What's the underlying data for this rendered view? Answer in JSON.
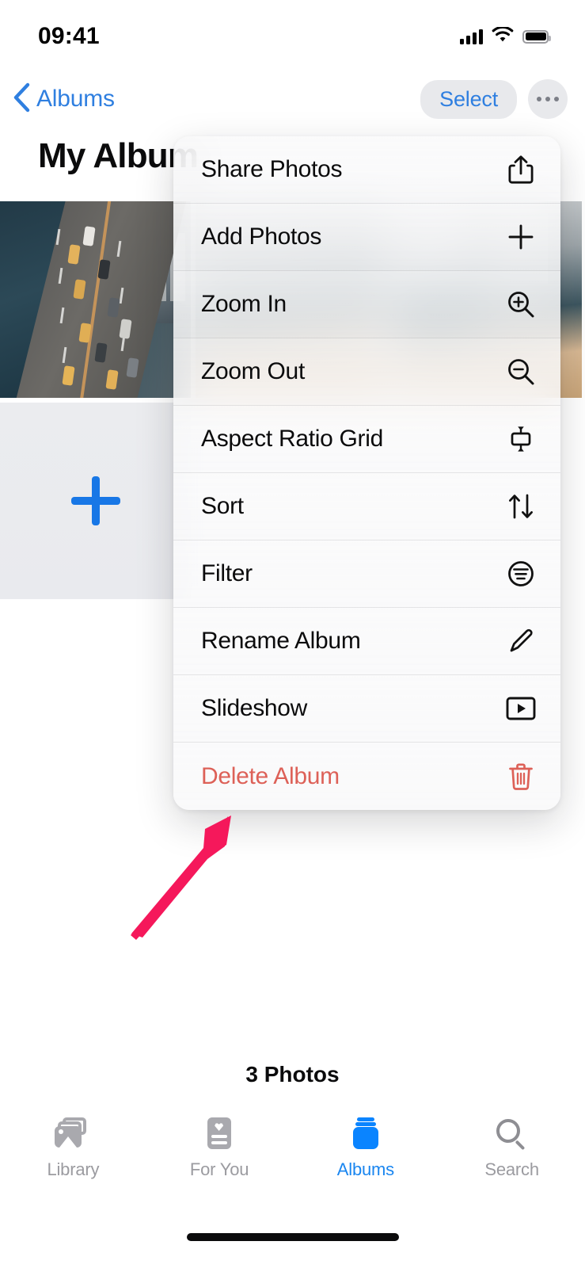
{
  "status_bar": {
    "time": "09:41",
    "cellular_icon": "signal-bars-icon",
    "wifi_icon": "wifi-icon",
    "battery_icon": "battery-full-icon"
  },
  "nav_bar": {
    "back_label": "Albums",
    "back_icon": "chevron-left-icon",
    "select_label": "Select",
    "more_icon": "ellipsis-icon"
  },
  "page": {
    "title": "My Album",
    "photo_count_label": "3 Photos"
  },
  "grid": {
    "add_tile_icon": "plus-icon",
    "photos": [
      {
        "alt": "aerial-highway-traffic"
      },
      {
        "alt": "city-street"
      },
      {
        "alt": "city-buildings"
      }
    ]
  },
  "context_menu": {
    "items": [
      {
        "label": "Share Photos",
        "icon": "share-icon",
        "destructive": false
      },
      {
        "label": "Add Photos",
        "icon": "plus-icon",
        "destructive": false
      },
      {
        "label": "Zoom In",
        "icon": "zoom-in-icon",
        "destructive": false
      },
      {
        "label": "Zoom Out",
        "icon": "zoom-out-icon",
        "destructive": false
      },
      {
        "label": "Aspect Ratio Grid",
        "icon": "aspect-ratio-icon",
        "destructive": false
      },
      {
        "label": "Sort",
        "icon": "sort-arrows-icon",
        "destructive": false
      },
      {
        "label": "Filter",
        "icon": "filter-icon",
        "destructive": false
      },
      {
        "label": "Rename Album",
        "icon": "pencil-icon",
        "destructive": false
      },
      {
        "label": "Slideshow",
        "icon": "play-box-icon",
        "destructive": false
      },
      {
        "label": "Delete Album",
        "icon": "trash-icon",
        "destructive": true
      }
    ]
  },
  "tab_bar": {
    "tabs": [
      {
        "label": "Library",
        "icon": "photo-stack-icon",
        "active": false
      },
      {
        "label": "For You",
        "icon": "for-you-card-icon",
        "active": false
      },
      {
        "label": "Albums",
        "icon": "albums-stack-icon",
        "active": true
      },
      {
        "label": "Search",
        "icon": "magnifier-icon",
        "active": false
      }
    ]
  },
  "annotation": {
    "arrow_icon": "pointer-arrow-icon",
    "arrow_color": "#F5185B",
    "points_at": "Delete Album"
  },
  "colors": {
    "accent_blue": "#0A84FF",
    "nav_blue": "#2F7FE0",
    "destructive_red": "#DD6158",
    "annotation_pink": "#F5185B",
    "menu_background": "#F7F8F9",
    "tab_inactive_gray": "#9B9BA0"
  }
}
